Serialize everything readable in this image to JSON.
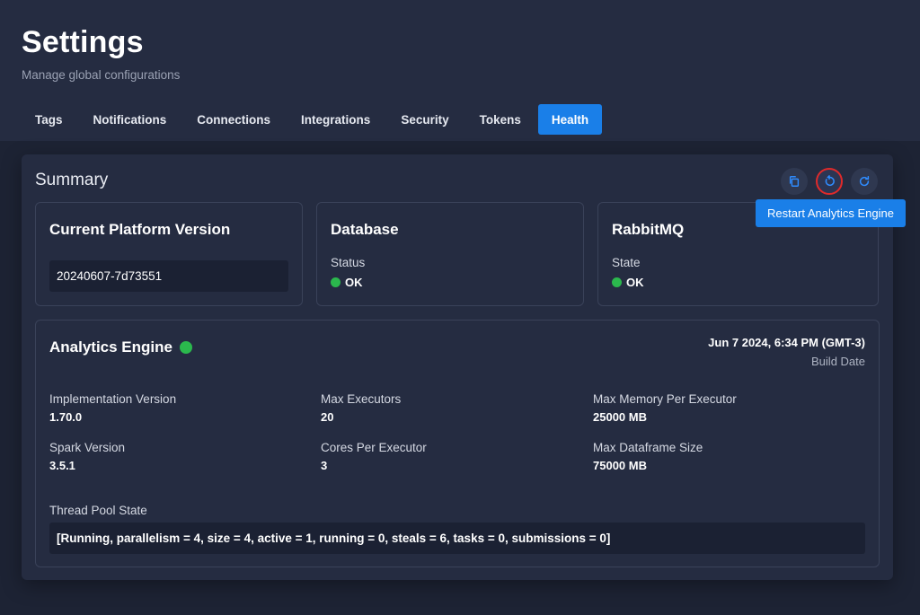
{
  "header": {
    "title": "Settings",
    "subtitle": "Manage global configurations"
  },
  "tabs": [
    {
      "label": "Tags"
    },
    {
      "label": "Notifications"
    },
    {
      "label": "Connections"
    },
    {
      "label": "Integrations"
    },
    {
      "label": "Security"
    },
    {
      "label": "Tokens"
    },
    {
      "label": "Health",
      "active": true
    }
  ],
  "summary": {
    "title": "Summary",
    "actions": {
      "copy_icon": "copy-icon",
      "restart_icon": "restart-icon",
      "refresh_icon": "refresh-icon"
    },
    "tooltip": "Restart Analytics Engine"
  },
  "cards": {
    "platform": {
      "title": "Current Platform Version",
      "version": "20240607-7d73551"
    },
    "database": {
      "title": "Database",
      "field_label": "Status",
      "status": "OK"
    },
    "rabbitmq": {
      "title": "RabbitMQ",
      "field_label": "State",
      "status": "OK"
    }
  },
  "engine": {
    "title": "Analytics Engine",
    "build_date": "Jun 7 2024, 6:34 PM (GMT-3)",
    "build_label": "Build Date",
    "stats": [
      {
        "label": "Implementation Version",
        "value": "1.70.0"
      },
      {
        "label": "Max Executors",
        "value": "20"
      },
      {
        "label": "Max Memory Per Executor",
        "value": "25000 MB"
      },
      {
        "label": "Spark Version",
        "value": "3.5.1"
      },
      {
        "label": "Cores Per Executor",
        "value": "3"
      },
      {
        "label": "Max Dataframe Size",
        "value": "75000 MB"
      }
    ],
    "thread_pool_label": "Thread Pool State",
    "thread_pool_state": "[Running, parallelism = 4, size = 4, active = 1, running = 0, steals = 6, tasks = 0, submissions = 0]"
  },
  "colors": {
    "accent": "#1a7fe8",
    "ok": "#2bb84d",
    "highlight": "#e02a2a"
  }
}
